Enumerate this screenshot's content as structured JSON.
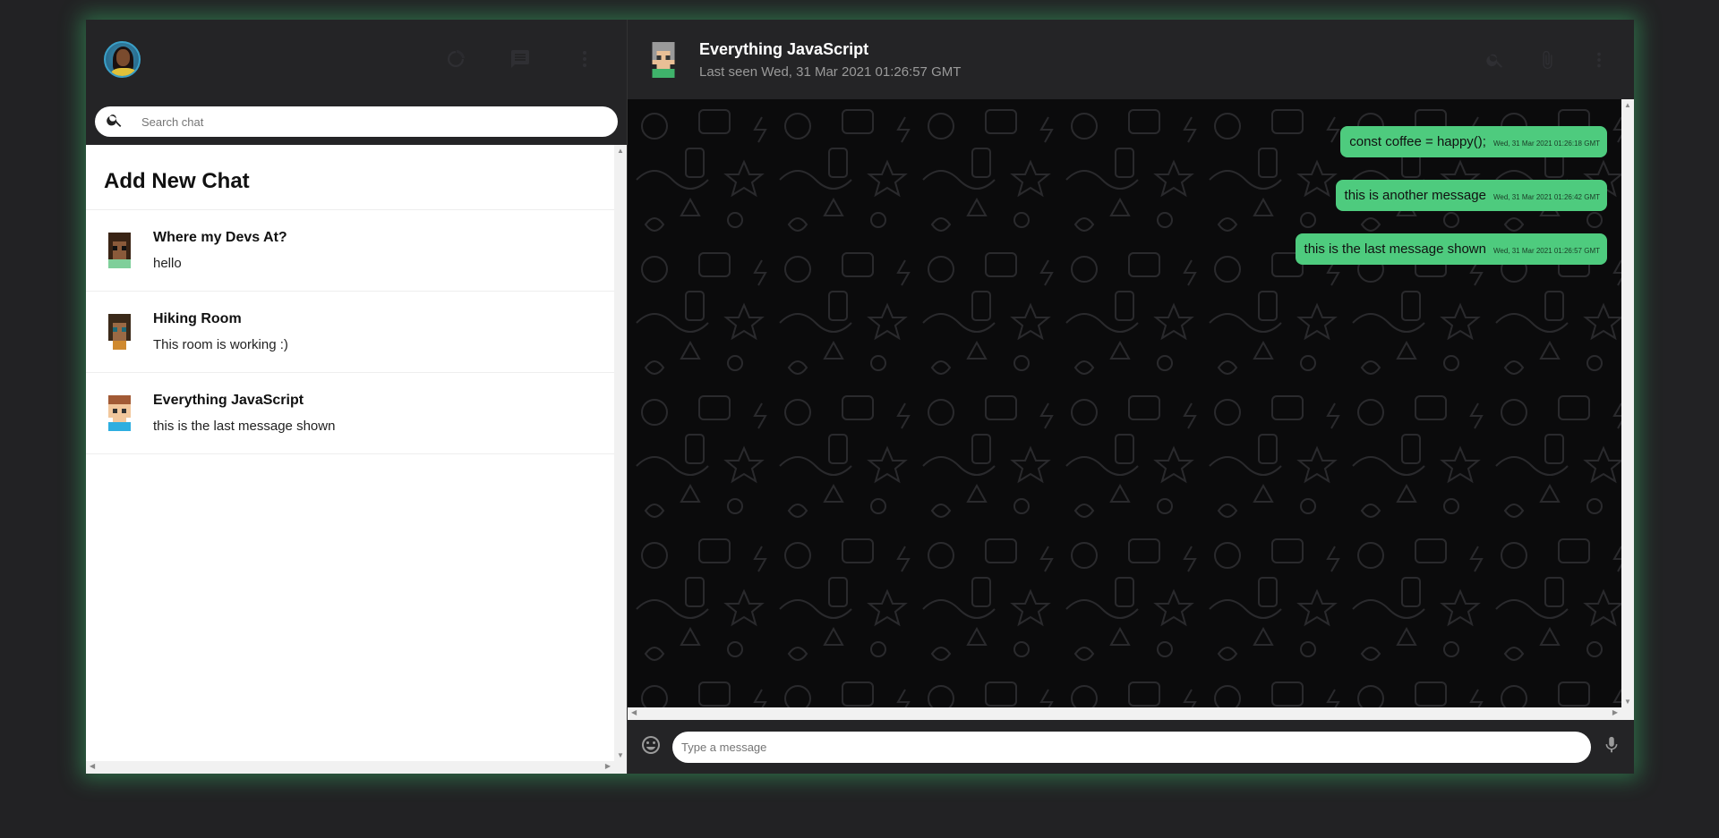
{
  "sidebar": {
    "search_placeholder": "Search chat",
    "add_new_chat": "Add New Chat",
    "chats": [
      {
        "name": "Where my Devs At?",
        "last_message": "hello"
      },
      {
        "name": "Hiking Room",
        "last_message": "This room is working :)"
      },
      {
        "name": "Everything JavaScript",
        "last_message": "this is the last message shown"
      }
    ]
  },
  "chat": {
    "room_name": "Everything JavaScript",
    "last_seen": "Last seen Wed, 31 Mar 2021 01:26:57 GMT",
    "messages": [
      {
        "text": "const coffee = happy();",
        "time": "Wed, 31 Mar 2021 01:26:18 GMT"
      },
      {
        "text": "this is another message",
        "time": "Wed, 31 Mar 2021 01:26:42 GMT"
      },
      {
        "text": "this is the last message shown",
        "time": "Wed, 31 Mar 2021 01:26:57 GMT"
      }
    ],
    "input_placeholder": "Type a message"
  },
  "colors": {
    "accent": "#4ecb7e",
    "header": "#242426",
    "background": "#222224"
  },
  "icons": [
    "avatar",
    "status-icon",
    "new-chat-icon",
    "more-vert-icon",
    "search-icon",
    "attach-icon",
    "emoji-icon",
    "mic-icon"
  ]
}
